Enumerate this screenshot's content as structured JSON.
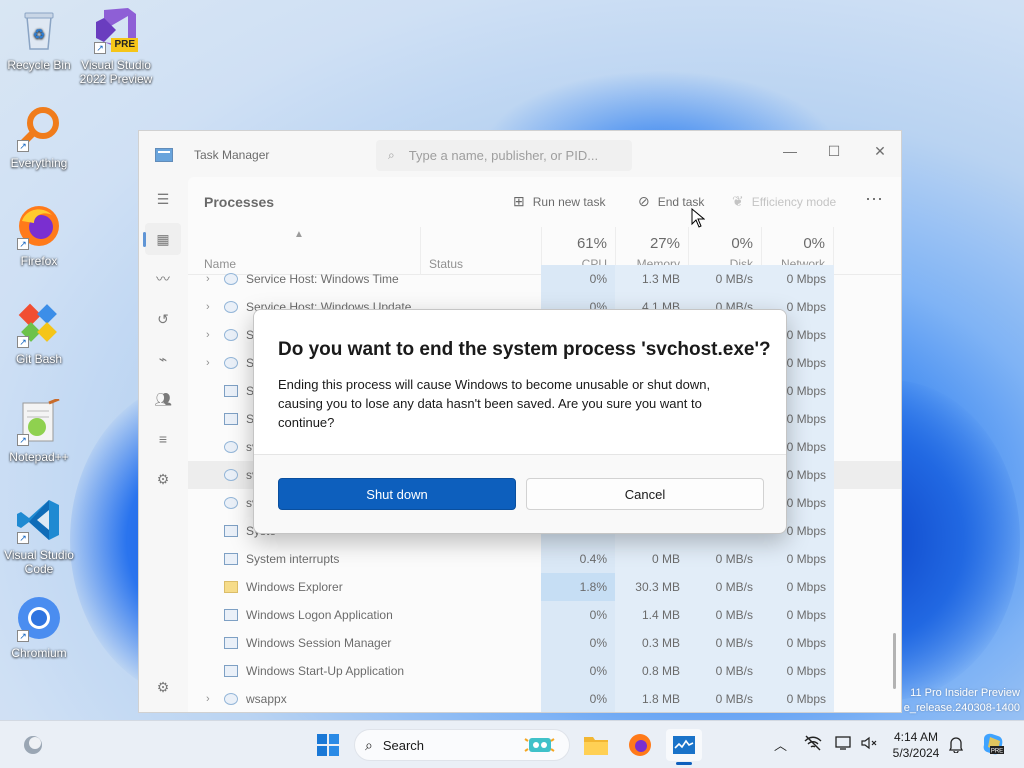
{
  "desktop": {
    "icons": [
      {
        "label": "Recycle Bin",
        "icon": "recycle-bin-icon"
      },
      {
        "label": "Visual Studio 2022 Preview",
        "icon": "visual-studio-preview-icon",
        "badge": "PRE"
      },
      {
        "label": "Everything",
        "icon": "everything-search-icon"
      },
      {
        "label": "Firefox",
        "icon": "firefox-icon"
      },
      {
        "label": "Git Bash",
        "icon": "git-bash-icon"
      },
      {
        "label": "Notepad++",
        "icon": "notepad-plus-plus-icon"
      },
      {
        "label": "Visual Studio Code",
        "icon": "vscode-icon"
      },
      {
        "label": "Chromium",
        "icon": "chromium-icon"
      }
    ],
    "watermark_line1": "11 Pro Insider Preview",
    "watermark_line2": "e_release.240308-1400"
  },
  "task_manager": {
    "title": "Task Manager",
    "search_placeholder": "Type a name, publisher, or PID...",
    "window_buttons": {
      "minimize": "—",
      "maximize": "☐",
      "close": "✕"
    },
    "page_heading": "Processes",
    "toolbar": {
      "run_new_task": "Run new task",
      "end_task": "End task",
      "efficiency_mode": "Efficiency mode",
      "more": "⋯"
    },
    "columns": {
      "name": "Name",
      "status": "Status",
      "cpu_pct": "61%",
      "cpu": "CPU",
      "memory_pct": "27%",
      "memory": "Memory",
      "disk_pct": "0%",
      "disk": "Disk",
      "network_pct": "0%",
      "network": "Network"
    },
    "rows": [
      {
        "name": "Service Host: Windows Time",
        "cpu": "0%",
        "memory": "1.3 MB",
        "disk": "0 MB/s",
        "network": "0 Mbps",
        "expand": true,
        "icon": "gear"
      },
      {
        "name": "Service Host: Windows Update",
        "cpu": "0%",
        "memory": "4.1 MB",
        "disk": "0 MB/s",
        "network": "0 Mbps",
        "expand": true,
        "icon": "gear"
      },
      {
        "name": "S",
        "cpu": "",
        "memory": "",
        "disk": "",
        "network": "0 Mbps",
        "expand": true,
        "icon": "gear"
      },
      {
        "name": "S",
        "cpu": "",
        "memory": "",
        "disk": "",
        "network": "0 Mbps",
        "expand": true,
        "icon": "gear"
      },
      {
        "name": "S",
        "cpu": "",
        "memory": "",
        "disk": "",
        "network": "0 Mbps",
        "expand": false,
        "icon": "window"
      },
      {
        "name": "S",
        "cpu": "",
        "memory": "",
        "disk": "",
        "network": "0 Mbps",
        "expand": false,
        "icon": "window"
      },
      {
        "name": "sv",
        "cpu": "",
        "memory": "",
        "disk": "",
        "network": "0 Mbps",
        "expand": false,
        "icon": "gear"
      },
      {
        "name": "sv",
        "cpu": "",
        "memory": "",
        "disk": "",
        "network": "0 Mbps",
        "expand": false,
        "icon": "gear",
        "selected": true
      },
      {
        "name": "sv",
        "cpu": "",
        "memory": "",
        "disk": "",
        "network": "0 Mbps",
        "expand": false,
        "icon": "gear"
      },
      {
        "name": "Syste",
        "cpu": "",
        "memory": "",
        "disk": "",
        "network": "0 Mbps",
        "expand": false,
        "icon": "window"
      },
      {
        "name": "System interrupts",
        "cpu": "0.4%",
        "memory": "0 MB",
        "disk": "0 MB/s",
        "network": "0 Mbps",
        "expand": false,
        "icon": "window"
      },
      {
        "name": "Windows Explorer",
        "cpu": "1.8%",
        "memory": "30.3 MB",
        "disk": "0 MB/s",
        "network": "0 Mbps",
        "expand": false,
        "icon": "folder",
        "hot": true
      },
      {
        "name": "Windows Logon Application",
        "cpu": "0%",
        "memory": "1.4 MB",
        "disk": "0 MB/s",
        "network": "0 Mbps",
        "expand": false,
        "icon": "window"
      },
      {
        "name": "Windows Session Manager",
        "cpu": "0%",
        "memory": "0.3 MB",
        "disk": "0 MB/s",
        "network": "0 Mbps",
        "expand": false,
        "icon": "window"
      },
      {
        "name": "Windows Start-Up Application",
        "cpu": "0%",
        "memory": "0.8 MB",
        "disk": "0 MB/s",
        "network": "0 Mbps",
        "expand": false,
        "icon": "window"
      },
      {
        "name": "wsappx",
        "cpu": "0%",
        "memory": "1.8 MB",
        "disk": "0 MB/s",
        "network": "0 Mbps",
        "expand": true,
        "icon": "gear"
      }
    ]
  },
  "dialog": {
    "title": "Do you want to end the system process 'svchost.exe'?",
    "message": "Ending this process will cause Windows to become unusable or shut down, causing you to lose any data hasn't been saved. Are you sure you want to continue?",
    "primary_button": "Shut down",
    "secondary_button": "Cancel"
  },
  "taskbar": {
    "search_label": "Search",
    "time": "4:14 AM",
    "date": "5/3/2024"
  },
  "colors": {
    "accent": "#0d5fbd",
    "cpu_column": "#c6dcf2",
    "resource_column": "#d3e4f5"
  }
}
